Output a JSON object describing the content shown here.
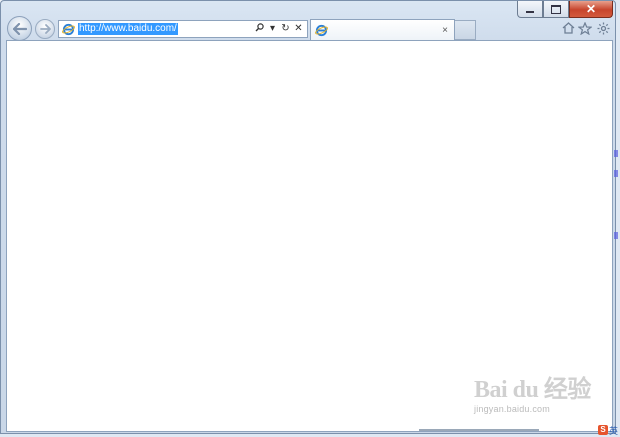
{
  "window": {
    "caption_buttons": {
      "minimize_icon": "minimize-icon",
      "maximize_icon": "maximize-icon",
      "close_icon": "close-icon",
      "close_glyph": "✕"
    }
  },
  "navigation": {
    "back_icon": "back-arrow-icon",
    "forward_icon": "forward-arrow-icon"
  },
  "address_bar": {
    "url": "http://www.baidu.com/",
    "url_selected": true,
    "site_icon": "ie-logo-icon",
    "search_glyph": "⚲",
    "dropdown_glyph": "▾",
    "refresh_glyph": "↻",
    "stop_glyph": "✕"
  },
  "tabs": [
    {
      "title": "",
      "close_glyph": "×",
      "icon": "ie-logo-icon",
      "active": true
    }
  ],
  "command_bar": {
    "home_icon": "home-icon",
    "favorites_icon": "star-icon",
    "tools_icon": "gear-icon"
  },
  "watermark": {
    "logo_text": "Bai du 经验",
    "sub_text": "jingyan.baidu.com"
  },
  "tray": {
    "icon_glyph": "S",
    "text": "英"
  },
  "colors": {
    "frame": "#c9d7e8",
    "selection": "#3399ff",
    "close_button": "#c7452d",
    "viewport": "#ffffff"
  }
}
